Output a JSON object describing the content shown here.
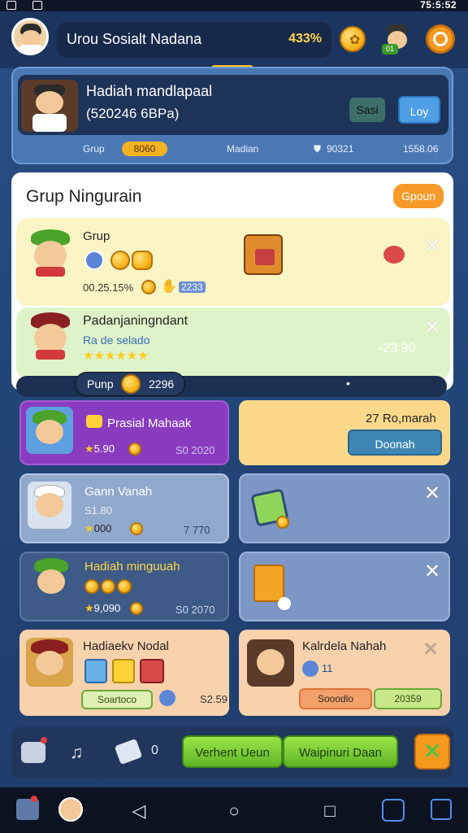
{
  "status_bar": {
    "time": "75:5:52"
  },
  "header": {
    "title": "Urou Sosialt Nadana",
    "percent": "433%",
    "badge": "01"
  },
  "hero": {
    "line1": "Hadiah mandlapaal",
    "line2": "(520246 6BPa)",
    "btn_secondary": "Sasi",
    "btn_primary": "Loy",
    "foot": {
      "left": "Grup",
      "left_val": "8060",
      "mid": "Madian",
      "mid_val": "90321",
      "right": "1558.06"
    }
  },
  "panel": {
    "title": "Grup Ningurain",
    "action": "Gpoun",
    "row1": {
      "name": "Grup",
      "stats": "00.25.15%",
      "extra": "2233"
    },
    "row2": {
      "name": "Padanjaningndant",
      "sub": "Ra de selado",
      "value": "-23.90"
    }
  },
  "divider": {
    "label": "Punp",
    "value": "2296"
  },
  "cards": [
    {
      "title": "Prasial Mahaak",
      "score": "5.90",
      "meta": "S0 2020"
    },
    {
      "title": "27 Ro,marah",
      "btn": "Doonah"
    },
    {
      "title": "Gann Vanah",
      "sub": "S1.80",
      "score": "000",
      "meta": "7 770"
    },
    {
      "title": "",
      "sub": ""
    },
    {
      "title": "Hadiah minguuah",
      "score": "9,090",
      "meta": "S0 2070"
    },
    {
      "title": "",
      "sub": ""
    },
    {
      "title": "Hadiaekv Nodal",
      "chip1": "Soartoco",
      "chip2": "S2.59"
    },
    {
      "title": "Kalrdela Nahah",
      "sub": "11",
      "chip1": "Sooodlo",
      "chip2": "20359"
    }
  ],
  "bottom": {
    "btn1": "Verhent Ueun",
    "btn2": "Waipinuri Daan",
    "small_text": "0"
  },
  "colors": {
    "accent_orange": "#f79a2a",
    "accent_green": "#5fb526",
    "purple": "#8a3cc0"
  }
}
